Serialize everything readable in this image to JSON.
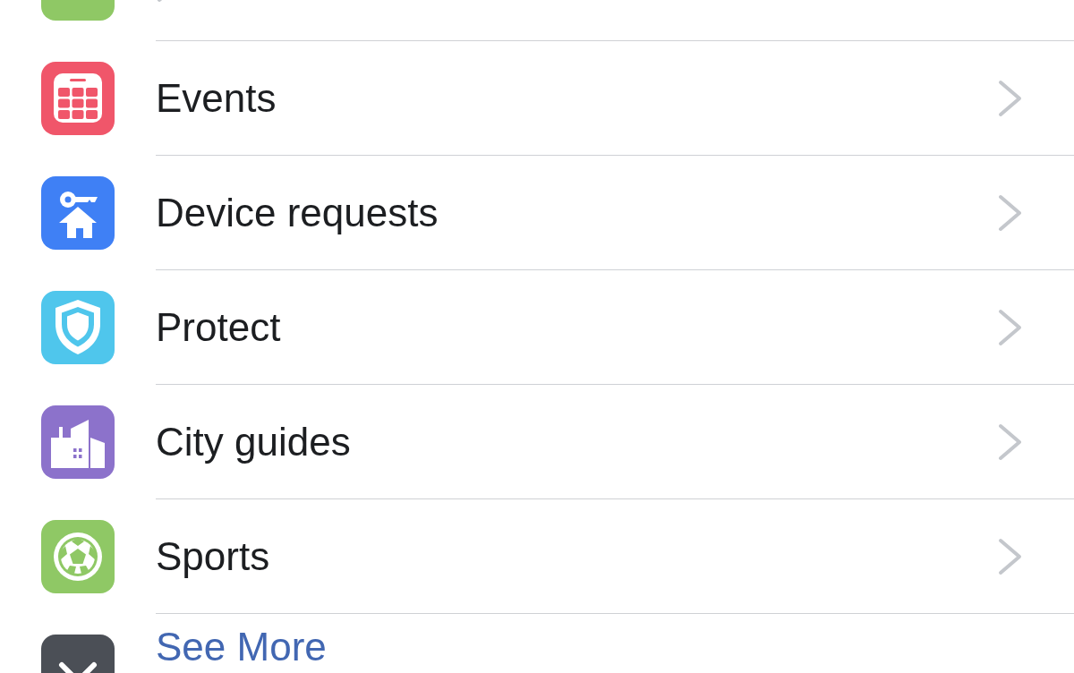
{
  "menu": [
    {
      "kind": "link"
    },
    {
      "kind": "link",
      "label": "Events"
    },
    {
      "kind": "link",
      "label": "Device requests"
    },
    {
      "kind": "link",
      "label": "Protect"
    },
    {
      "kind": "link",
      "label": "City guides"
    },
    {
      "kind": "link",
      "label": "Sports"
    },
    {
      "kind": "more",
      "label": "See More"
    }
  ]
}
